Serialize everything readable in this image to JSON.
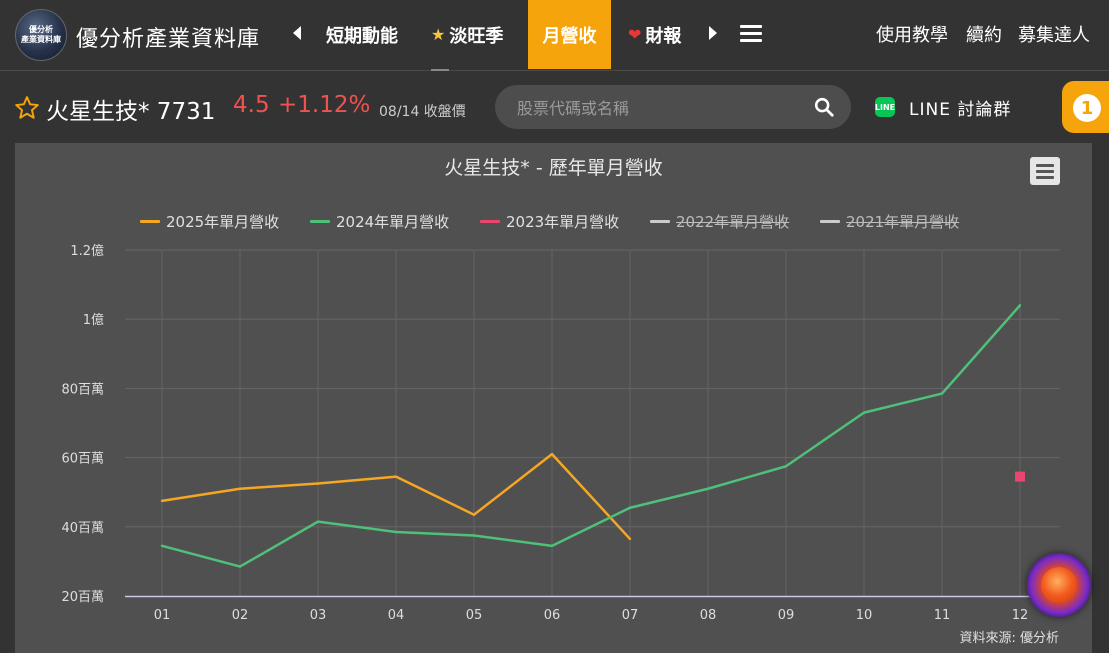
{
  "nav": {
    "logo_line1": "優分析",
    "logo_line2": "產業資料庫",
    "site_title": "優分析產業資料庫",
    "tabs": [
      {
        "label": "短期動能",
        "icon": ""
      },
      {
        "label": "淡旺季",
        "icon": "★"
      },
      {
        "label": "月營收",
        "icon": ""
      },
      {
        "label": "財報",
        "icon": "❤"
      }
    ],
    "right_links": [
      "使用教學",
      "續約",
      "募集達人"
    ]
  },
  "stock": {
    "name": "火星生技* 7731",
    "price": "4.5",
    "change": "+1.12%",
    "date_note": "08/14 收盤價"
  },
  "search": {
    "placeholder": "股票代碼或名稱"
  },
  "line_button": {
    "icon_text": "LINE",
    "label": "LINE 討論群"
  },
  "badge": {
    "count": "1"
  },
  "colors": {
    "accent": "#f5a40c",
    "price_up": "#f0524f",
    "series_2025": "#f5a623",
    "series_2024": "#4fc07a",
    "series_2023": "#e8456f",
    "series_hidden": "#cccccc"
  },
  "chart_data": {
    "type": "line",
    "title": "火星生技* - 歷年單月營收",
    "categories": [
      "01",
      "02",
      "03",
      "04",
      "05",
      "06",
      "07",
      "08",
      "09",
      "10",
      "11",
      "12"
    ],
    "y_tick_labels": [
      "20百萬",
      "40百萬",
      "60百萬",
      "80百萬",
      "1億",
      "1.2億"
    ],
    "y_ticks": [
      20000000,
      40000000,
      60000000,
      80000000,
      100000000,
      120000000
    ],
    "ylim": [
      20000000,
      120000000
    ],
    "grid": true,
    "legend_position": "top",
    "series": [
      {
        "name": "2025年單月營收",
        "color": "#f5a623",
        "visible": true,
        "values": [
          47500000,
          51000000,
          52500000,
          54500000,
          43500000,
          61000000,
          36500000,
          null,
          null,
          null,
          null,
          null
        ]
      },
      {
        "name": "2024年單月營收",
        "color": "#4fc07a",
        "visible": true,
        "values": [
          34500000,
          28500000,
          41500000,
          38500000,
          37500000,
          34500000,
          45500000,
          51000000,
          57500000,
          73000000,
          78500000,
          104000000
        ]
      },
      {
        "name": "2023年單月營收",
        "color": "#e8456f",
        "visible": true,
        "values": [
          null,
          null,
          null,
          null,
          null,
          null,
          null,
          null,
          null,
          null,
          null,
          54500000
        ]
      },
      {
        "name": "2022年單月營收",
        "color": "#cccccc",
        "visible": false,
        "values": []
      },
      {
        "name": "2021年單月營收",
        "color": "#cccccc",
        "visible": false,
        "values": []
      }
    ],
    "credit": "資料來源: 優分析"
  }
}
